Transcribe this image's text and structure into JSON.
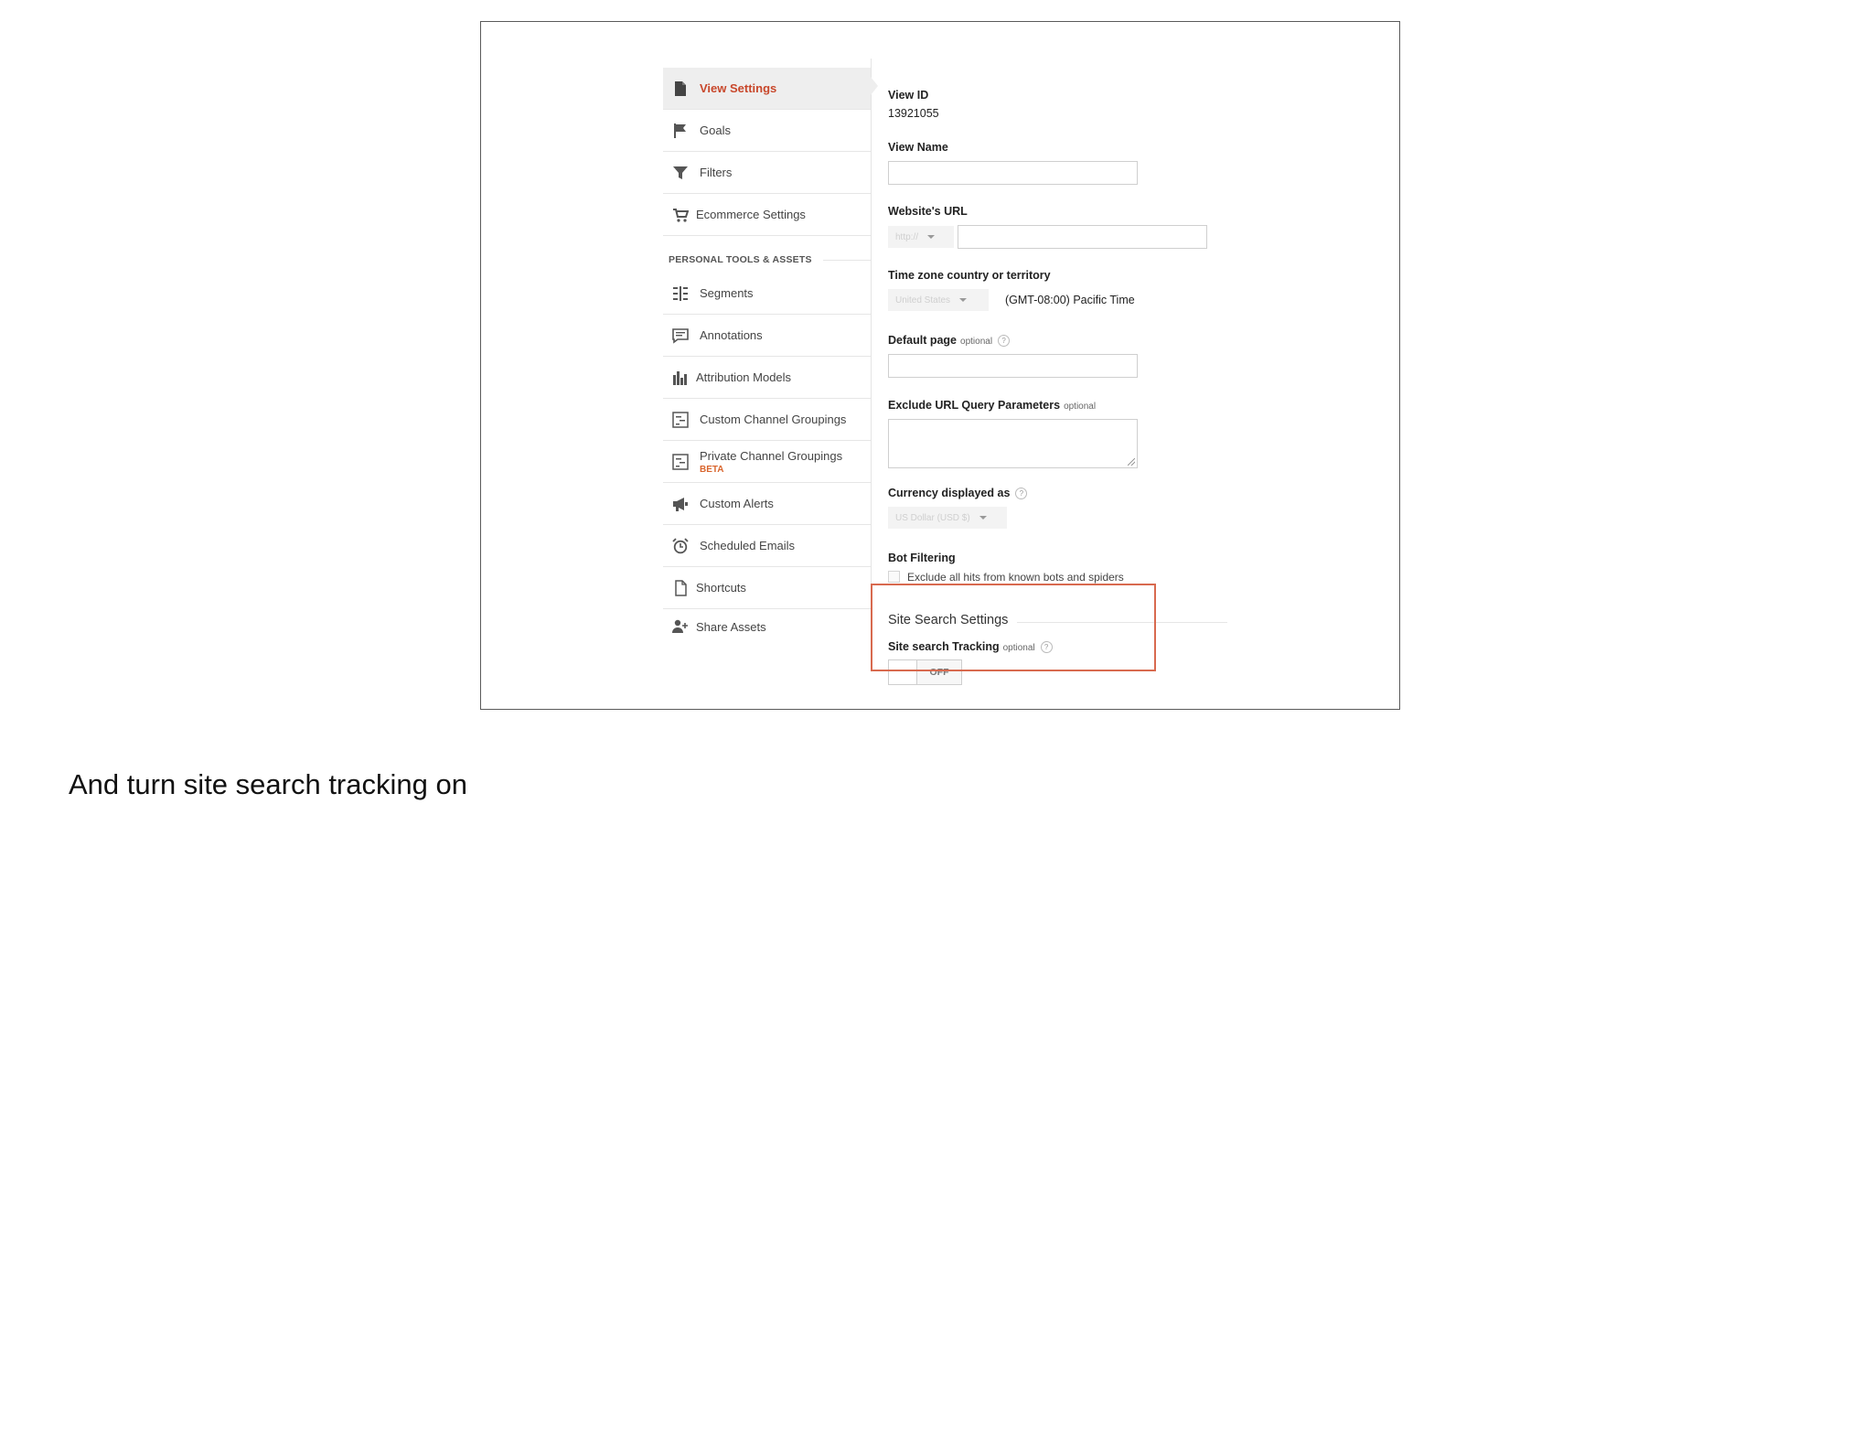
{
  "sidebar": {
    "items": [
      {
        "label": "View Settings",
        "icon": "document-icon"
      },
      {
        "label": "Goals",
        "icon": "flag-icon"
      },
      {
        "label": "Filters",
        "icon": "filter-icon"
      },
      {
        "label": "Ecommerce Settings",
        "icon": "cart-icon"
      }
    ],
    "section_heading": "PERSONAL TOOLS & ASSETS",
    "tools": [
      {
        "label": "Segments",
        "icon": "segments-icon"
      },
      {
        "label": "Annotations",
        "icon": "annotation-icon"
      },
      {
        "label": "Attribution Models",
        "icon": "bar-chart-icon"
      },
      {
        "label": "Custom Channel Groupings",
        "icon": "channel-grouping-icon"
      },
      {
        "label": "Private Channel Groupings",
        "badge": "BETA",
        "icon": "channel-grouping-icon"
      },
      {
        "label": "Custom Alerts",
        "icon": "megaphone-icon"
      },
      {
        "label": "Scheduled Emails",
        "icon": "alarm-clock-icon"
      },
      {
        "label": "Shortcuts",
        "icon": "shortcut-icon"
      },
      {
        "label": "Share Assets",
        "icon": "add-user-icon"
      }
    ]
  },
  "form": {
    "view_id": {
      "label": "View ID",
      "value": "13921055"
    },
    "view_name": {
      "label": "View Name",
      "value": ""
    },
    "website_url": {
      "label": "Website's URL",
      "protocol": "http://",
      "value": ""
    },
    "timezone": {
      "label": "Time zone country or territory",
      "country": "United States",
      "zone": "(GMT-08:00) Pacific Time"
    },
    "default_page": {
      "label": "Default page",
      "optional": "optional",
      "value": ""
    },
    "exclude_params": {
      "label": "Exclude URL Query Parameters",
      "optional": "optional",
      "value": ""
    },
    "currency": {
      "label": "Currency displayed as",
      "value": "US Dollar (USD $)"
    },
    "bot_filtering": {
      "label": "Bot Filtering",
      "checkbox_label": "Exclude all hits from known bots and spiders",
      "checked": false
    },
    "site_search": {
      "section_title": "Site Search Settings",
      "label": "Site search Tracking",
      "optional": "optional",
      "toggle_state": "OFF"
    }
  },
  "caption": "And turn site search tracking on",
  "colors": {
    "accent": "#c8472b",
    "highlight_border": "#d86a4f",
    "beta": "#d9652d"
  }
}
